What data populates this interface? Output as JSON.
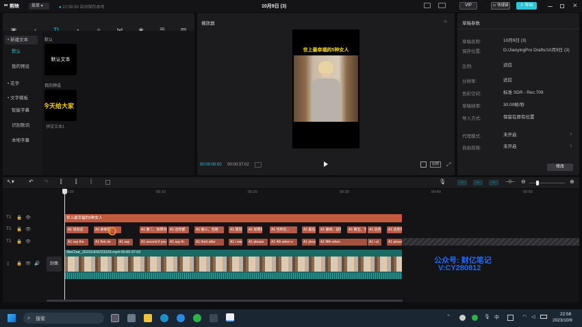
{
  "titlebar": {
    "logo": "剪映",
    "menu": "菜单",
    "autosave": "22:58:39 自动保存本地",
    "title": "10月9日 (3)",
    "vip": "VIP",
    "shortcut": "快捷键",
    "export": "导出"
  },
  "toolbar": {
    "items": [
      {
        "icon": "media-icon",
        "glyph": "▣",
        "label": "媒体"
      },
      {
        "icon": "audio-icon",
        "glyph": "♪",
        "label": "音频"
      },
      {
        "icon": "text-icon",
        "glyph": "TI",
        "label": "文本"
      },
      {
        "icon": "sticker-icon",
        "glyph": "◔",
        "label": "贴纸"
      },
      {
        "icon": "effects-icon",
        "glyph": "✧",
        "label": "特效"
      },
      {
        "icon": "transition-icon",
        "glyph": "⋈",
        "label": "转场"
      },
      {
        "icon": "filter-icon",
        "glyph": "❀",
        "label": "滤镜"
      },
      {
        "icon": "adjust-icon",
        "glyph": "☰",
        "label": "调节"
      },
      {
        "icon": "template-icon",
        "glyph": "▤",
        "label": "模板"
      }
    ]
  },
  "sidebar": {
    "items": [
      "• 新建文本",
      "默认",
      "我的预设",
      "• 花字",
      "• 文字模板",
      "智能字幕",
      "识别歌词",
      "本地字幕"
    ]
  },
  "library": {
    "section_default": "默认",
    "default_card": "默认文本",
    "section_preset": "我的预设",
    "preset_card": "今天给大家",
    "preset_label": "预设文本1"
  },
  "player": {
    "header": "播放器",
    "overlay_title": "世上最幸福的5种女人",
    "time_current": "00:00:00:00",
    "time_total": "00:00:37:02",
    "ratio_btn": "比例"
  },
  "draft": {
    "header": "草稿参数",
    "rows": [
      {
        "label": "草稿名称:",
        "value": "10月9日 (3)"
      },
      {
        "label": "保存位置:",
        "value": "D:/JianyingPro Drafts/10月9日 (3)"
      },
      {
        "label": "比例:",
        "value": "适应"
      },
      {
        "label": "分辨率:",
        "value": "适应"
      },
      {
        "label": "色彩空间:",
        "value": "标准 SDR - Rec.709"
      },
      {
        "label": "草稿帧率:",
        "value": "30.00帧/秒"
      },
      {
        "label": "导入方式:",
        "value": "保留在原有位置"
      },
      {
        "label": "代理模式:",
        "value": "未开启"
      },
      {
        "label": "自由层级:",
        "value": "未开启"
      }
    ],
    "edit_btn": "修改"
  },
  "timeline": {
    "ticks": [
      "00:00",
      "00:10",
      "00:20",
      "00:30",
      "00:40",
      "00:50"
    ],
    "title_clip": "世上最幸福的5种女人",
    "cn_clips": [
      "A1 说出这",
      "A1 幸幸福",
      "A1 第二、如果对",
      "A1 这样都",
      "A1 第三、当她",
      "A1 我觉得",
      "A1 如果能",
      "A1 当你在...",
      "A1 最后一",
      "A1 第四、说你们",
      "A1 第五、当我",
      "A1 这些美",
      "A1 这些男人"
    ],
    "en_clips": [
      "A1 say the",
      "A1 first.do",
      "A1 say",
      "A1 second if you",
      "A1 say th",
      "A1 third after",
      "A1 i was",
      "A1 please",
      "A1 4th when o",
      "A1 pleas",
      "A1 fifth when",
      "A1 i al",
      "A1 please"
    ],
    "video_label": "WeChat_20231009223229.mp4   00:00:37:02",
    "cover": "封面",
    "watermark1": "公众号: 财亿笔记",
    "watermark2": "V:CY280812",
    "track_labels": [
      "T1",
      "T1",
      "T1"
    ]
  },
  "taskbar": {
    "search": "搜索",
    "ime": "中",
    "time": "22:58",
    "date": "2023/10/9"
  },
  "colors": {
    "accent": "#2fc4d6",
    "title_clip": "#c4593f",
    "text_clip": "#b85a46",
    "video_bar": "#1a6b68",
    "watermark": "#1e6bff"
  }
}
